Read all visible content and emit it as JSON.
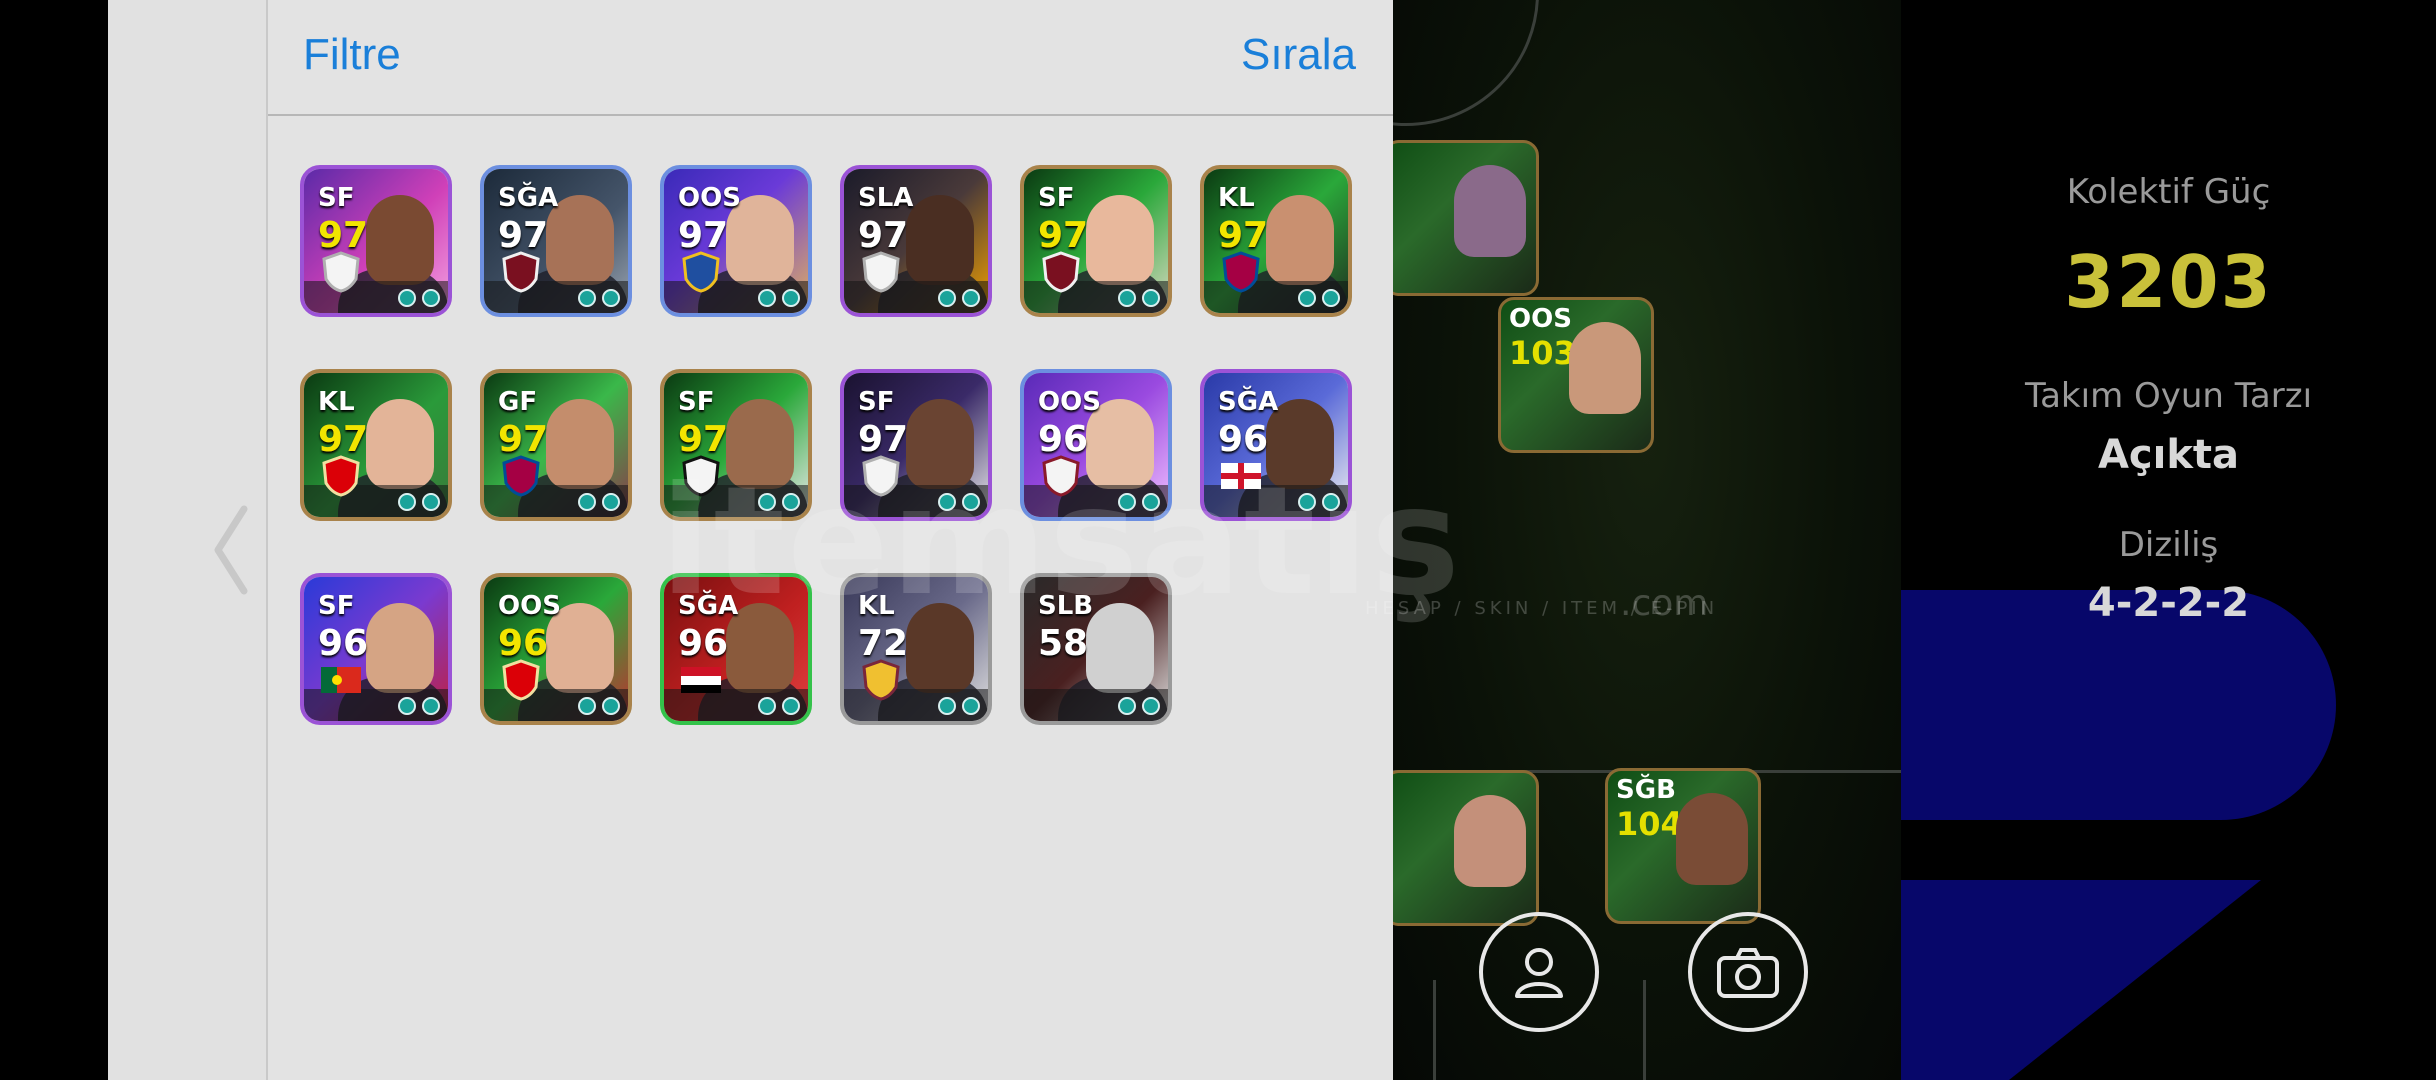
{
  "drawer": {
    "filter_label": "Filtre",
    "sort_label": "Sırala"
  },
  "cards": [
    {
      "pos": "SF",
      "rating": "97",
      "rating_color": "#f2e500",
      "border": "purple",
      "bg": "linear-gradient(135deg,#5b2aa8,#d040b8 55%,#f2a0e0)",
      "skin": "#7a4a32",
      "badge": "white-crest"
    },
    {
      "pos": "SĞA",
      "rating": "97",
      "rating_color": "#ffffff",
      "border": "blue",
      "bg": "linear-gradient(135deg,#1c2a3a,#45556a 60%,#9aa4b0)",
      "skin": "#a77257",
      "badge": "red-crest"
    },
    {
      "pos": "OOS",
      "rating": "97",
      "rating_color": "#ffffff",
      "border": "blue",
      "bg": "linear-gradient(135deg,#3a2ab8,#6a3ad8 45%,#e0b060)",
      "skin": "#e0b49a",
      "badge": "blue-crest"
    },
    {
      "pos": "SLA",
      "rating": "97",
      "rating_color": "#ffffff",
      "border": "purple",
      "bg": "linear-gradient(135deg,#1b1b2a,#4a3a3a 50%,#f0a000)",
      "skin": "#4a2e22",
      "badge": "white-crest"
    },
    {
      "pos": "SF",
      "rating": "97",
      "rating_color": "#f2e500",
      "border": "gold",
      "bg": "linear-gradient(135deg,#0b3a12,#2aa83a 50%,#d8d8c0)",
      "skin": "#e8b89c",
      "badge": "red-crest"
    },
    {
      "pos": "KL",
      "rating": "97",
      "rating_color": "#f2e500",
      "border": "gold",
      "bg": "linear-gradient(135deg,#0b3a12,#2aa83a 50%,#203020)",
      "skin": "#c99070",
      "badge": "barca-crest"
    },
    {
      "pos": "KL",
      "rating": "97",
      "rating_color": "#f2e500",
      "border": "gold",
      "bg": "linear-gradient(135deg,#0b3a12,#2a9a3a 55%,#3a7a3a)",
      "skin": "#e3b498",
      "badge": "arsenal-crest"
    },
    {
      "pos": "GF",
      "rating": "97",
      "rating_color": "#f2e500",
      "border": "gold",
      "bg": "linear-gradient(135deg,#0b3a12,#3ab84a 50%,#8a3a4a)",
      "skin": "#c48d6c",
      "badge": "barca-crest"
    },
    {
      "pos": "SF",
      "rating": "97",
      "rating_color": "#f2e500",
      "border": "gold",
      "bg": "linear-gradient(135deg,#0b3a12,#2aa83a 50%,#e8e8e8)",
      "skin": "#9a6a4c",
      "badge": "santos-crest"
    },
    {
      "pos": "SF",
      "rating": "97",
      "rating_color": "#ffffff",
      "border": "purple",
      "bg": "linear-gradient(135deg,#1a1230,#3a2a68 50%,#e8e8e8)",
      "skin": "#6a4432",
      "badge": "white-crest"
    },
    {
      "pos": "OOS",
      "rating": "96",
      "rating_color": "#ffffff",
      "border": "blue",
      "bg": "linear-gradient(135deg,#5a2ab8,#9a4ae0 50%,#f0c0ff)",
      "skin": "#e6bea4",
      "badge": "vissel-crest"
    },
    {
      "pos": "SĞA",
      "rating": "96",
      "rating_color": "#ffffff",
      "border": "purple",
      "bg": "linear-gradient(135deg,#2a3aa8,#5a6ad8 50%,#f0f0f0)",
      "skin": "#5a3a2a",
      "badge": "england-flag"
    },
    {
      "pos": "SF",
      "rating": "96",
      "rating_color": "#ffffff",
      "border": "purple",
      "bg": "linear-gradient(135deg,#2a3ad8,#7a3ad0 50%,#c02040)",
      "skin": "#d5a484",
      "badge": "portugal-flag"
    },
    {
      "pos": "OOS",
      "rating": "96",
      "rating_color": "#f2e500",
      "border": "gold",
      "bg": "linear-gradient(135deg,#0b3a12,#2aa83a 50%,#c03030)",
      "skin": "#e0b094",
      "badge": "arsenal-crest"
    },
    {
      "pos": "SĞA",
      "rating": "96",
      "rating_color": "#ffffff",
      "border": "green",
      "bg": "linear-gradient(135deg,#7a1010,#c02020 55%,#e04040)",
      "skin": "#8a5a3c",
      "badge": "egypt-flag"
    },
    {
      "pos": "KL",
      "rating": "72",
      "rating_color": "#ffffff",
      "border": "grey",
      "bg": "linear-gradient(135deg,#3a3a5a,#6a6a8a 50%,#e0e0e0)",
      "skin": "#5a3828",
      "badge": "westham-crest"
    },
    {
      "pos": "SLB",
      "rating": "58",
      "rating_color": "#ffffff",
      "border": "grey",
      "bg": "linear-gradient(135deg,#2a2a2a,#4a2020 50%,#dddddd)",
      "skin": "#d0d0d0",
      "badge": "none"
    }
  ],
  "team": {
    "collective_label": "Kolektif Güç",
    "collective_value": "3203",
    "playstyle_label": "Takım Oyun Tarzı",
    "playstyle_value": "Açıkta",
    "formation_label": "Diziliş",
    "formation_value": "4-2-2-2"
  },
  "pitch_cards": [
    {
      "pos": "",
      "rating": "",
      "partial": true
    },
    {
      "pos": "OOS",
      "rating": "103"
    },
    {
      "pos": "",
      "rating": "",
      "partial": true
    },
    {
      "pos": "SĞB",
      "rating": "104"
    }
  ],
  "watermark": {
    "text": "itemsatış",
    "sub": "HESAP / SKIN / ITEM / E-PIN",
    "com": ".com"
  },
  "icons": [
    "chevron-left-icon",
    "profile-icon",
    "camera-icon"
  ]
}
